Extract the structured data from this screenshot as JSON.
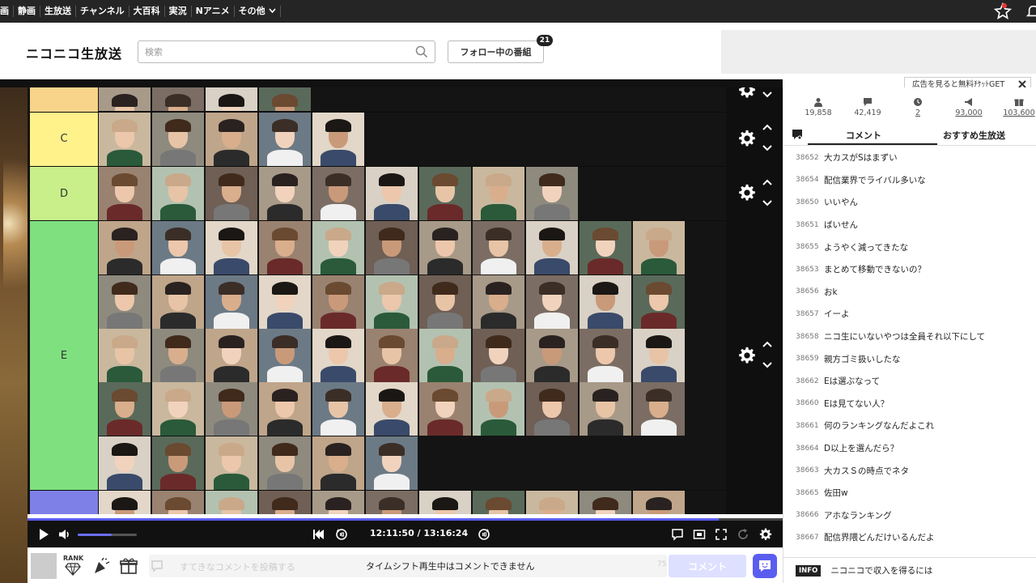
{
  "topnav": {
    "items": [
      "画",
      "静画",
      "生放送",
      "チャンネル",
      "大百科",
      "実況",
      "Nアニメ",
      "その他"
    ]
  },
  "header": {
    "logo": "ニコニコ生放送",
    "search_placeholder": "検索",
    "follow_label": "フォロー中の番組",
    "follow_count": "21"
  },
  "ad": {
    "tag": "広告を見ると無料ﾁｹｯﾄGET"
  },
  "player": {
    "tiers": [
      "C",
      "D",
      "E"
    ],
    "time": "12:11:50 / 13:16:24",
    "progress": 0.915,
    "volume": 0.58
  },
  "comment_bar": {
    "rank_label": "RANK",
    "placeholder": "すてきなコメントを投稿する",
    "message": "タイムシフト再生中はコメントできません",
    "char_count": "75",
    "send_label": "コメント"
  },
  "stats": {
    "viewers": "19,858",
    "comments": "42,419",
    "timeshift": "2",
    "ads": "93,000",
    "gifts": "103,600"
  },
  "tabs": {
    "comment": "コメント",
    "recommend": "おすすめ生放送"
  },
  "comments": [
    {
      "no": "38652",
      "text": "大カスがSはまずい"
    },
    {
      "no": "38654",
      "text": "配信業界でライバル多いな"
    },
    {
      "no": "38650",
      "text": "いいやん"
    },
    {
      "no": "38651",
      "text": "ばいせん"
    },
    {
      "no": "38655",
      "text": "ようやく減ってきたな"
    },
    {
      "no": "38653",
      "text": "まとめて移動できないの？"
    },
    {
      "no": "38656",
      "text": "おk"
    },
    {
      "no": "38657",
      "text": "イーよ"
    },
    {
      "no": "38658",
      "text": "ニコ生にいないやつは全員それ以下にして"
    },
    {
      "no": "38659",
      "text": "親方ゴミ扱いしたな"
    },
    {
      "no": "38662",
      "text": "Eは選ぶなって"
    },
    {
      "no": "38660",
      "text": "Eは見てない人？"
    },
    {
      "no": "38661",
      "text": "何のランキングなんだよこれ"
    },
    {
      "no": "38664",
      "text": "D以上を選んだら？"
    },
    {
      "no": "38663",
      "text": "大カスＳの時点でネタ"
    },
    {
      "no": "38665",
      "text": "佐田w"
    },
    {
      "no": "38666",
      "text": "アホなランキング"
    },
    {
      "no": "38667",
      "text": "配信界隈どんだけいるんだよ"
    }
  ],
  "info": {
    "badge": "INFO",
    "text": "ニコニコで収入を得るには"
  }
}
